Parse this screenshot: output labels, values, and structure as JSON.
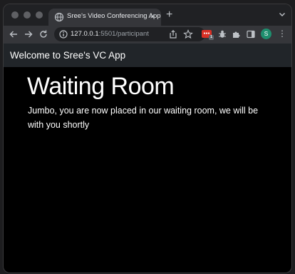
{
  "browser": {
    "tab": {
      "title": "Sree's Video Conferencing App",
      "close_glyph": "×",
      "icon": "globe-icon"
    },
    "new_tab_glyph": "+",
    "omnibox": {
      "url_host": "127.0.0.1",
      "url_rest": ":5501/participant",
      "icon": "info-icon"
    },
    "extension_badge": {
      "label": "●●●",
      "count": "1"
    },
    "profile_initial": "S",
    "menu_glyph": "⋮"
  },
  "page": {
    "brand": "Welcome to Sree's VC App",
    "heading": "Waiting Room",
    "message": "Jumbo, you are now placed in our waiting room, we will be with you shortly"
  },
  "colors": {
    "navbar": "#212529",
    "page_bg": "#000000",
    "profile": "#1e8e6e",
    "extension": "#d93025"
  }
}
